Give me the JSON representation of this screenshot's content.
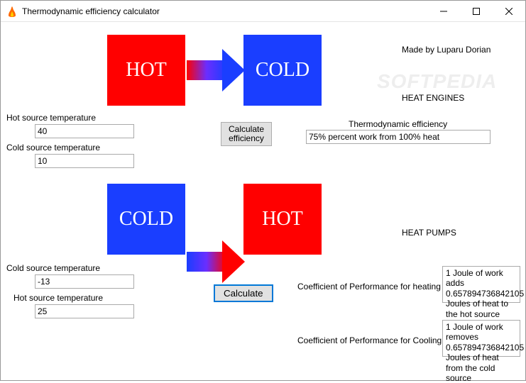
{
  "window": {
    "title": "Thermodynamic efficiency calculator"
  },
  "credit": "Made by Luparu Dorian",
  "watermark": "SOFTPEDIA",
  "section1": {
    "hot_label": "HOT",
    "cold_label": "COLD",
    "title": "HEAT ENGINES",
    "hot_source_label": "Hot source temperature",
    "hot_source_value": "40",
    "cold_source_label": "Cold source temperature",
    "cold_source_value": "10",
    "calc_button": "Calculate efficiency",
    "output_label": "Thermodynamic efficiency",
    "output_value": "75% percent work from 100% heat"
  },
  "section2": {
    "cold_label": "COLD",
    "hot_label": "HOT",
    "title": "HEAT PUMPS",
    "cold_source_label": "Cold source temperature",
    "cold_source_value": "-13",
    "hot_source_label": "Hot source temperature",
    "hot_source_value": "25",
    "calc_button": "Calculate",
    "cop_heating_label": "Coefficient of Performance for heating",
    "cop_heating_value": "1 Joule of work adds 0.657894736842105 Joules of heat to the hot source",
    "cop_cooling_label": "Coefficient of Performance for Cooling",
    "cop_cooling_value": "1 Joule of work removes 0.657894736842105 Joules of heat from the cold source"
  }
}
